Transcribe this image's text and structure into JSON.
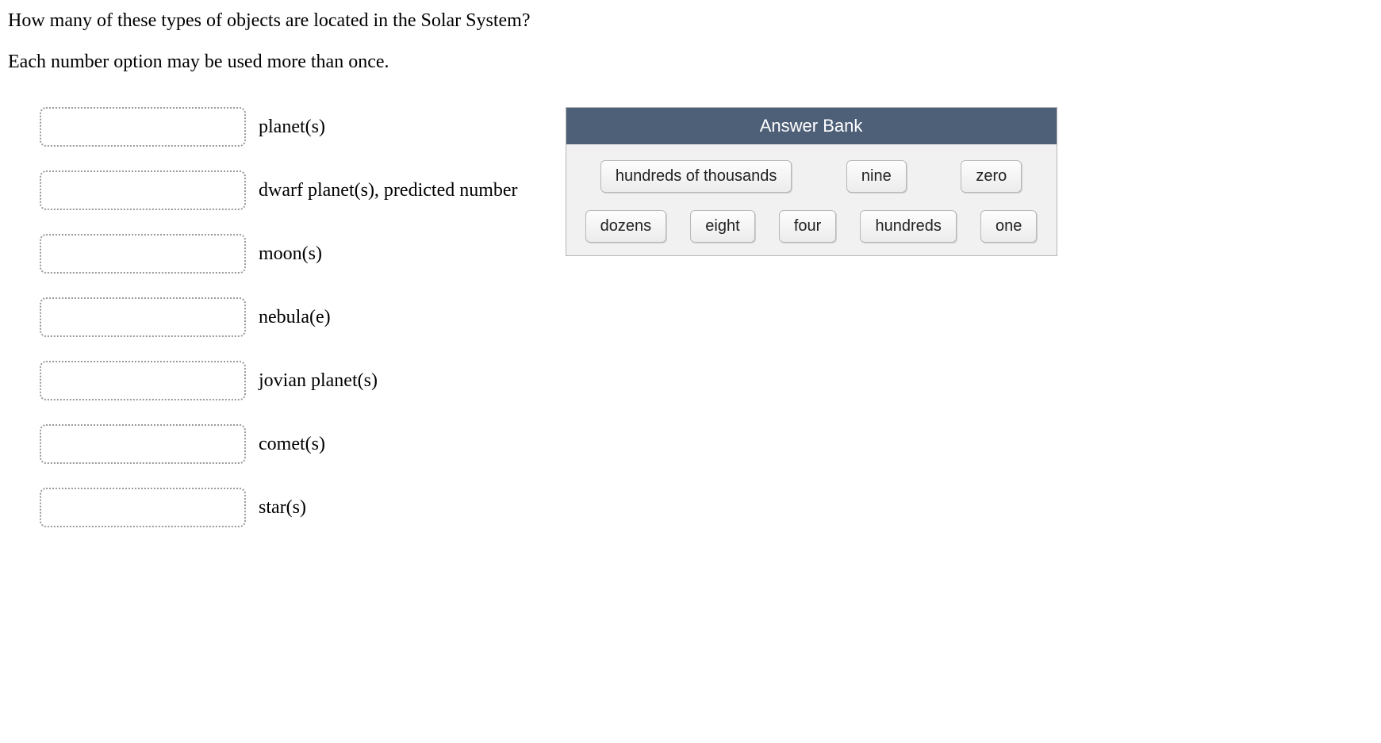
{
  "question": {
    "line1": "How many of these types of objects are located in the Solar System?",
    "line2": "Each number option may be used more than once."
  },
  "targets": [
    {
      "label": "planet(s)"
    },
    {
      "label": "dwarf planet(s), predicted number"
    },
    {
      "label": "moon(s)"
    },
    {
      "label": "nebula(e)"
    },
    {
      "label": "jovian planet(s)"
    },
    {
      "label": "comet(s)"
    },
    {
      "label": "star(s)"
    }
  ],
  "answerBank": {
    "title": "Answer Bank",
    "row1": [
      "hundreds of thousands",
      "nine",
      "zero"
    ],
    "row2": [
      "dozens",
      "eight",
      "four",
      "hundreds",
      "one"
    ]
  }
}
